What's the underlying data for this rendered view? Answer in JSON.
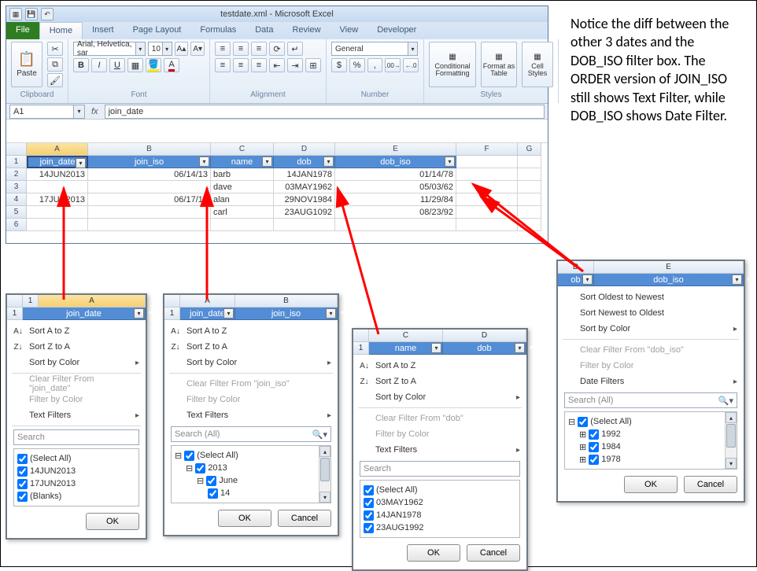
{
  "annotation": "Notice the diff between the other 3 dates and the DOB_ISO filter box. The ORDER version of JOIN_ISO still shows Text Filter, while DOB_ISO shows Date Filter.",
  "title": "testdate.xml - Microsoft Excel",
  "tabs": {
    "file": "File",
    "home": "Home",
    "insert": "Insert",
    "page": "Page Layout",
    "formulas": "Formulas",
    "data": "Data",
    "review": "Review",
    "view": "View",
    "dev": "Developer"
  },
  "groups": {
    "clipboard": "Clipboard",
    "font": "Font",
    "alignment": "Alignment",
    "number": "Number",
    "styles": "Styles"
  },
  "font": {
    "name": "Arial, Helvetica, sar",
    "size": "10",
    "general": "General"
  },
  "styles": {
    "cf": "Conditional Formatting",
    "fat": "Format as Table",
    "cs": "Cell Styles"
  },
  "paste": "Paste",
  "namebox": "A1",
  "formula": "join_date",
  "cols": [
    "A",
    "B",
    "C",
    "D",
    "E",
    "F",
    "G"
  ],
  "headers": [
    "join_date",
    "join_iso",
    "name",
    "dob",
    "dob_iso"
  ],
  "rows": [
    {
      "n": "2",
      "a": "14JUN2013",
      "b": "06/14/13",
      "c": "barb",
      "d": "14JAN1978",
      "e": "01/14/78"
    },
    {
      "n": "3",
      "a": "",
      "b": "",
      "c": "dave",
      "d": "03MAY1962",
      "e": "05/03/62"
    },
    {
      "n": "4",
      "a": "17JUN2013",
      "b": "06/17/13",
      "c": "alan",
      "d": "29NOV1984",
      "e": "11/29/84"
    },
    {
      "n": "5",
      "a": "",
      "b": "",
      "c": "carl",
      "d": "23AUG1092",
      "e": "08/23/92"
    },
    {
      "n": "6",
      "a": "",
      "b": "",
      "c": "",
      "d": "",
      "e": ""
    }
  ],
  "menu": {
    "sortAZ": "Sort A to Z",
    "sortZA": "Sort Z to A",
    "sortColor": "Sort by Color",
    "sortOld": "Sort Oldest to Newest",
    "sortNew": "Sort Newest to Oldest",
    "clearJD": "Clear Filter From \"join_date\"",
    "clearJI": "Clear Filter From \"join_iso\"",
    "clearDob": "Clear Filter From \"dob\"",
    "clearDobIso": "Clear Filter From \"dob_iso\"",
    "filterColor": "Filter by Color",
    "textFilters": "Text Filters",
    "dateFilters": "Date Filters",
    "search": "Search",
    "searchAll": "Search (All)",
    "selectAll": "(Select All)",
    "ok": "OK",
    "cancel": "Cancel",
    "blanks": "(Blanks)"
  },
  "p1": {
    "col": "A",
    "head": "join_date",
    "items": [
      "14JUN2013",
      "17JUN2013"
    ]
  },
  "p2": {
    "colA": "A",
    "colB": "B",
    "headA": "join_date",
    "headB": "join_iso",
    "y": "2013",
    "m": "June",
    "d": "14"
  },
  "p3": {
    "colC": "C",
    "colD": "D",
    "headC": "name",
    "headD": "dob",
    "items": [
      "03MAY1962",
      "14JAN1978",
      "23AUG1992"
    ]
  },
  "p4": {
    "colD": "D",
    "colE": "E",
    "headD": "ob",
    "headE": "dob_iso",
    "items": [
      "1992",
      "1984",
      "1978"
    ]
  }
}
